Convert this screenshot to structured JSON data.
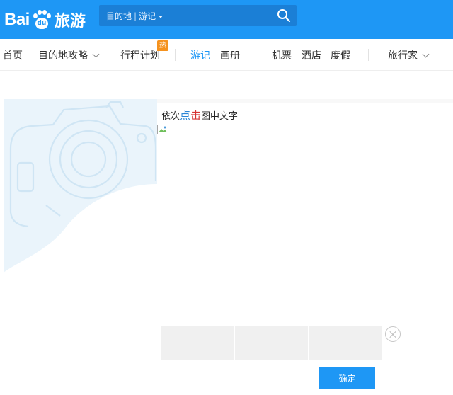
{
  "brand": {
    "name_latin": "Bai",
    "name_paw": "du",
    "name_cn": "旅游"
  },
  "search": {
    "destination": "目的地",
    "separator": "|",
    "scope": "游记",
    "icon": "search-icon"
  },
  "nav": {
    "items": [
      {
        "label": "首页"
      },
      {
        "label": "目的地攻略"
      },
      {
        "label": "行程计划"
      },
      {
        "label": "游记"
      },
      {
        "label": "画册"
      },
      {
        "label": "机票"
      },
      {
        "label": "酒店"
      },
      {
        "label": "度假"
      },
      {
        "label": "旅行家"
      }
    ],
    "hot_badge": "热"
  },
  "captcha": {
    "instruction_prefix": "依次",
    "char1": "点",
    "char2": "击",
    "instruction_suffix": "图中文字",
    "confirm_label": "确定"
  },
  "colors": {
    "header": "#1e97f5",
    "accent": "#1e97f5",
    "highlight_red": "#d63333"
  }
}
